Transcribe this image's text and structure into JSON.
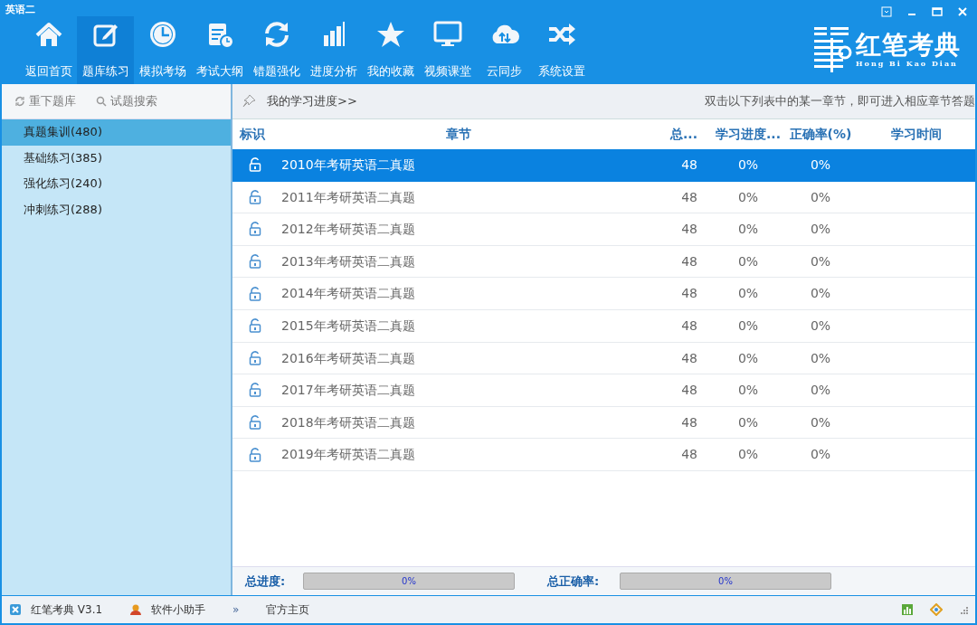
{
  "window": {
    "title": "英语二"
  },
  "toolbar": [
    {
      "label": "返回首页",
      "kind": "home",
      "selected": false
    },
    {
      "label": "题库练习",
      "kind": "edit",
      "selected": true
    },
    {
      "label": "模拟考场",
      "kind": "clock",
      "selected": false
    },
    {
      "label": "考试大纲",
      "kind": "calendar",
      "selected": false
    },
    {
      "label": "错题强化",
      "kind": "refresh",
      "selected": false
    },
    {
      "label": "进度分析",
      "kind": "bars",
      "selected": false
    },
    {
      "label": "我的收藏",
      "kind": "star",
      "selected": false
    },
    {
      "label": "视频课堂",
      "kind": "monitor",
      "selected": false
    },
    {
      "label": "云同步",
      "kind": "cloud",
      "selected": false
    },
    {
      "label": "系统设置",
      "kind": "shuffle",
      "selected": false
    }
  ],
  "logo": {
    "name": "红笔考典",
    "subtitle": "Hong Bi Kao Dian"
  },
  "sidebar": {
    "actions": [
      {
        "label": "重下题库",
        "kind": "reload"
      },
      {
        "label": "试题搜索",
        "kind": "search"
      }
    ],
    "items": [
      {
        "label": "真题集训(480)",
        "selected": true
      },
      {
        "label": "基础练习(385)",
        "selected": false
      },
      {
        "label": "强化练习(240)",
        "selected": false
      },
      {
        "label": "冲刺练习(288)",
        "selected": false
      }
    ]
  },
  "progress_header": {
    "title": "我的学习进度>>",
    "hint": "双击以下列表中的某一章节，即可进入相应章节答题"
  },
  "table": {
    "columns": [
      "标识",
      "章节",
      "总...",
      "学习进度...",
      "正确率(%)",
      "学习时间"
    ],
    "rows": [
      {
        "chapter": "2010年考研英语二真题",
        "total": "48",
        "progress": "0%",
        "accuracy": "0%",
        "selected": true
      },
      {
        "chapter": "2011年考研英语二真题",
        "total": "48",
        "progress": "0%",
        "accuracy": "0%",
        "selected": false
      },
      {
        "chapter": "2012年考研英语二真题",
        "total": "48",
        "progress": "0%",
        "accuracy": "0%",
        "selected": false
      },
      {
        "chapter": "2013年考研英语二真题",
        "total": "48",
        "progress": "0%",
        "accuracy": "0%",
        "selected": false
      },
      {
        "chapter": "2014年考研英语二真题",
        "total": "48",
        "progress": "0%",
        "accuracy": "0%",
        "selected": false
      },
      {
        "chapter": "2015年考研英语二真题",
        "total": "48",
        "progress": "0%",
        "accuracy": "0%",
        "selected": false
      },
      {
        "chapter": "2016年考研英语二真题",
        "total": "48",
        "progress": "0%",
        "accuracy": "0%",
        "selected": false
      },
      {
        "chapter": "2017年考研英语二真题",
        "total": "48",
        "progress": "0%",
        "accuracy": "0%",
        "selected": false
      },
      {
        "chapter": "2018年考研英语二真题",
        "total": "48",
        "progress": "0%",
        "accuracy": "0%",
        "selected": false
      },
      {
        "chapter": "2019年考研英语二真题",
        "total": "48",
        "progress": "0%",
        "accuracy": "0%",
        "selected": false
      }
    ]
  },
  "summary": [
    {
      "label": "总进度:",
      "level": 0,
      "reading": "0%"
    },
    {
      "label": "总正确率:",
      "level": 0,
      "reading": "0%"
    }
  ],
  "status_bar": [
    {
      "label": "红笔考典 V3.1",
      "kind": "app"
    },
    {
      "label": "软件小助手",
      "kind": "helper"
    },
    {
      "label": "»",
      "kind": "glyph"
    },
    {
      "label": "官方主页",
      "kind": "plain"
    }
  ]
}
